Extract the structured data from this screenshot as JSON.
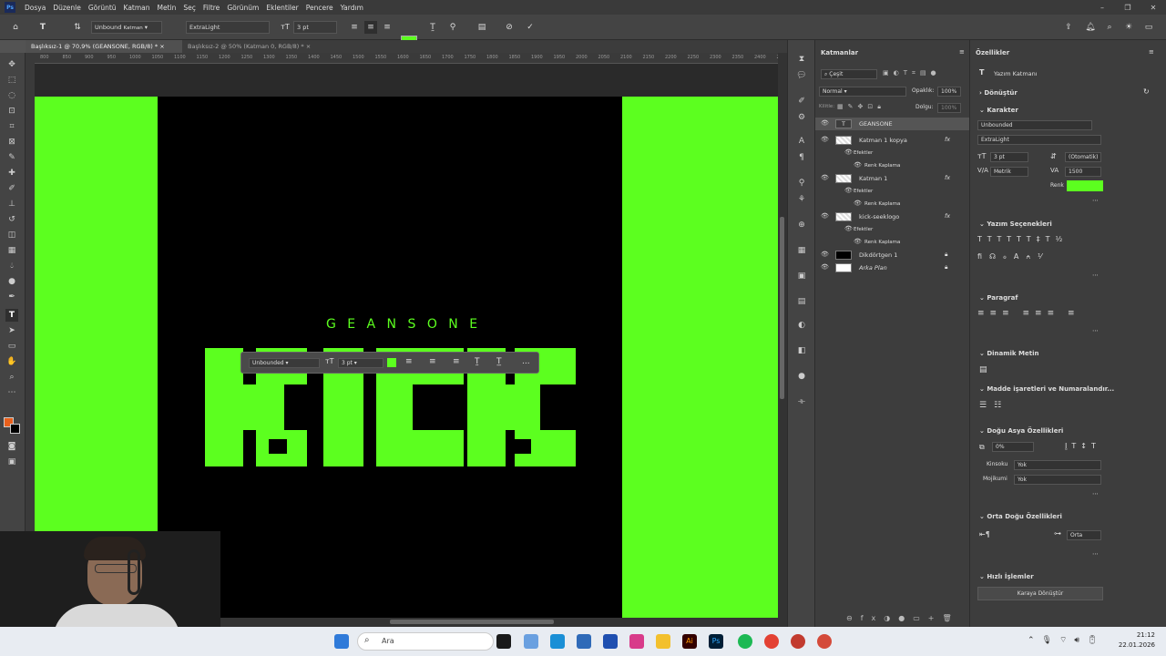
{
  "app": {
    "logo": "Ps"
  },
  "menu": [
    "Dosya",
    "Düzenle",
    "Görüntü",
    "Katman",
    "Metin",
    "Seç",
    "Filtre",
    "Görünüm",
    "Eklentiler",
    "Pencere",
    "Yardım"
  ],
  "options": {
    "font_family": "Unbound",
    "font_family_hint": "Katman",
    "font_style": "ExtraLight",
    "font_size": "3 pt"
  },
  "colors": {
    "accent_green": "#5cff1f",
    "canvas_black": "#000000",
    "fg_swatch": "#e8601c"
  },
  "tabs": [
    {
      "label": "Başlıksız-1 @ 70,9% (GEANSONE, RGB/8) *",
      "active": true
    },
    {
      "label": "Başlıksız-2 @ 50% (Katman 0, RGB/8) *",
      "active": false
    }
  ],
  "ruler_labels": [
    "800",
    "850",
    "900",
    "950",
    "1000",
    "1050",
    "1100",
    "1150",
    "1200",
    "1250",
    "1300",
    "1350",
    "1400",
    "1450",
    "1500",
    "1550",
    "1600",
    "1650",
    "1700",
    "1750",
    "1800",
    "1850",
    "1900",
    "1950",
    "2000",
    "2050",
    "2100",
    "2150",
    "2200",
    "2250",
    "2300",
    "2350",
    "2400",
    "2450"
  ],
  "canvas": {
    "top_text": "G E A N S O N E",
    "main_text": "KICK"
  },
  "float_toolbar": {
    "font": "Unbounded",
    "size": "3 pt",
    "more": "..."
  },
  "layers_panel": {
    "title": "Katmanlar",
    "search": "Çeşit",
    "blend": "Normal",
    "opacity_label": "Opaklık:",
    "opacity": "100%",
    "lock_label": "Kilitle:",
    "fill_label": "Dolgu:",
    "fill": "100%",
    "layers": [
      {
        "name": "GEANSONE",
        "kind": "text",
        "selected": true
      },
      {
        "name": "Katman 1 kopya",
        "kind": "img",
        "fx": "fx"
      },
      {
        "name": "Efektler",
        "kind": "sub"
      },
      {
        "name": "Renk Kaplama",
        "kind": "sub2"
      },
      {
        "name": "Katman 1",
        "kind": "img",
        "fx": "fx"
      },
      {
        "name": "Efektler",
        "kind": "sub"
      },
      {
        "name": "Renk Kaplama",
        "kind": "sub2"
      },
      {
        "name": "kick-seeklogo",
        "kind": "img",
        "fx": "fx"
      },
      {
        "name": "Efektler",
        "kind": "sub"
      },
      {
        "name": "Renk Kaplama",
        "kind": "sub2"
      },
      {
        "name": "Dikdörtgen 1",
        "kind": "shape"
      },
      {
        "name": "Arka Plan",
        "kind": "bg"
      }
    ]
  },
  "properties": {
    "title": "Özellikler",
    "type_label": "Yazım Katmanı",
    "transform": "Dönüştür",
    "character": "Karakter",
    "font": "Unbounded",
    "style": "ExtraLight",
    "size": "3 pt",
    "leading": "(Otomatik)",
    "kerning": "Metrik",
    "tracking": "1500",
    "color_label": "Renk",
    "type_options": "Yazım Seçenekleri",
    "paragraph": "Paragraf",
    "dynamic_text": "Dinamik Metin",
    "bullets": "Madde işaretleri ve Numaralandır...",
    "east_asian": "Doğu Asya Özellikleri",
    "ea_percent": "0%",
    "kinsoku_label": "Kinsoku",
    "kinsoku": "Yok",
    "mojikumi_label": "Mojikumi",
    "mojikumi": "Yok",
    "middle_east": "Orta Doğu Özellikleri",
    "me_value": "Orta",
    "quick_actions": "Hızlı İşlemler",
    "convert_btn": "Karaya Dönüştür"
  },
  "taskbar": {
    "search": "Ara",
    "time": "21:12",
    "date": "22.01.2026"
  }
}
